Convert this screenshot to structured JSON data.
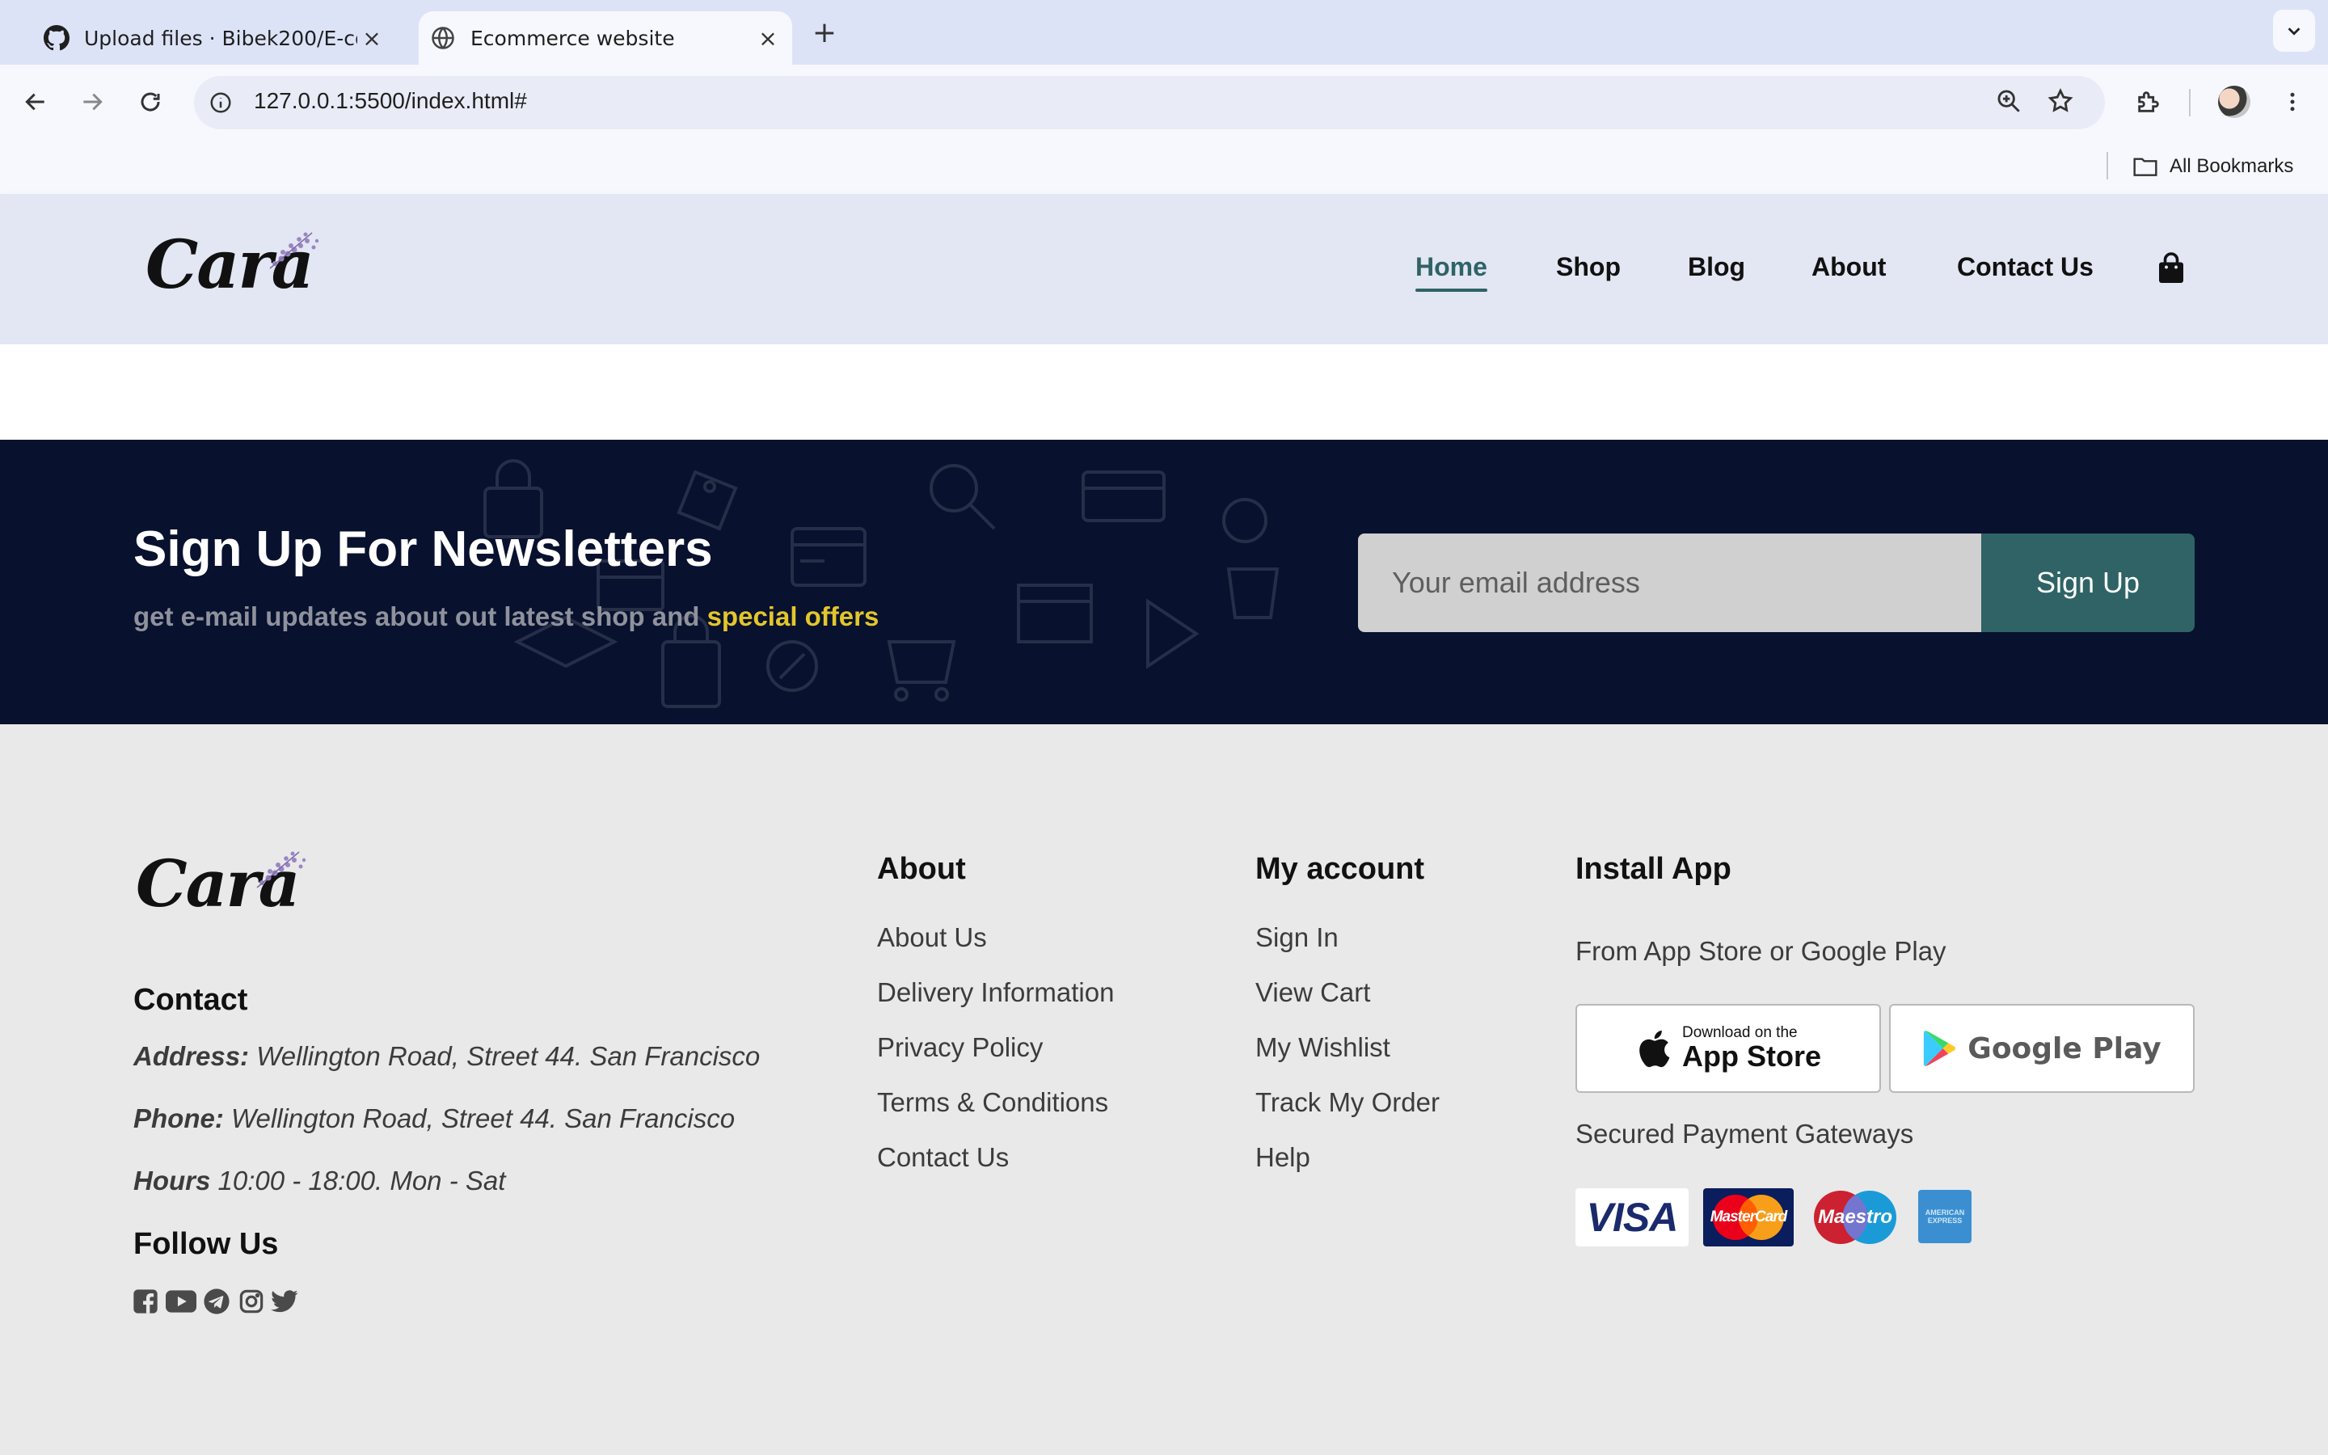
{
  "browser": {
    "tabs": [
      {
        "title": "Upload files · Bibek200/E-com",
        "active": false,
        "icon": "github-icon"
      },
      {
        "title": "Ecommerce website",
        "active": true,
        "icon": "globe-icon"
      }
    ],
    "url": "127.0.0.1:5500/index.html#",
    "bookmarks_label": "All Bookmarks"
  },
  "header": {
    "logo_text": "Cara",
    "nav": [
      {
        "label": "Home",
        "active": true
      },
      {
        "label": "Shop"
      },
      {
        "label": "Blog"
      },
      {
        "label": "About"
      },
      {
        "label": "Contact Us"
      }
    ],
    "cart_icon": "shopping-bag-icon"
  },
  "newsletter": {
    "title": "Sign Up For Newsletters",
    "subtitle_prefix": "get e-mail updates about out latest shop and",
    "subtitle_highlight": "special offers",
    "placeholder": "Your email address",
    "button": "Sign Up",
    "colors": {
      "background": "#08112e",
      "accent": "#2f6366",
      "highlight": "#e3c62c"
    }
  },
  "footer": {
    "logo_text": "Cara",
    "contact_heading": "Contact",
    "address_label": "Address:",
    "address_value": "Wellington Road, Street 44. San Francisco",
    "phone_label": "Phone:",
    "phone_value": "Wellington Road, Street 44. San Francisco",
    "hours_label": "Hours",
    "hours_value": "10:00 - 18:00. Mon - Sat",
    "follow_heading": "Follow Us",
    "social_icons": [
      "facebook-icon",
      "youtube-icon",
      "telegram-icon",
      "instagram-icon",
      "twitter-icon"
    ],
    "about_heading": "About",
    "about_links": [
      "About Us",
      "Delivery Information",
      "Privacy Policy",
      "Terms & Conditions",
      "Contact Us"
    ],
    "account_heading": "My account",
    "account_links": [
      "Sign In",
      "View Cart",
      "My Wishlist",
      "Track My Order",
      "Help"
    ],
    "app_heading": "Install App",
    "app_text": "From App Store or Google Play",
    "appstore_small": "Download on the",
    "appstore_big": "App Store",
    "googleplay": "Google Play",
    "payment_text": "Secured Payment Gateways",
    "payment_cards": [
      "VISA",
      "MasterCard",
      "Maestro",
      "AMERICAN EXPRESS"
    ]
  }
}
